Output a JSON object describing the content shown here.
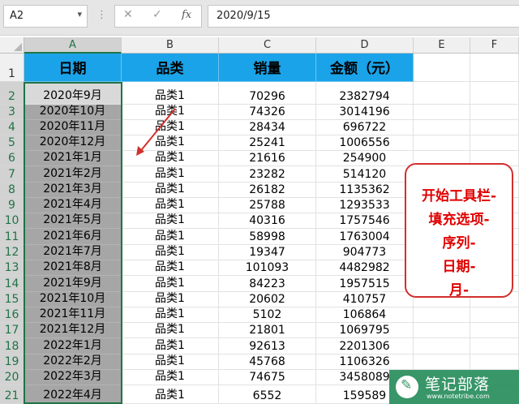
{
  "formula_bar": {
    "name_box": "A2",
    "name_box_arrow": "▾",
    "separator": "⋮",
    "cancel_glyph": "✕",
    "enter_glyph": "✓",
    "fx_glyph": "fx",
    "formula_value": "2020/9/15"
  },
  "columns": [
    "A",
    "B",
    "C",
    "D",
    "E",
    "F"
  ],
  "rows": [
    "1",
    "2",
    "3",
    "4",
    "5",
    "6",
    "7",
    "8",
    "9",
    "10",
    "11",
    "12",
    "13",
    "14",
    "15",
    "16",
    "17",
    "18",
    "19",
    "20",
    "21"
  ],
  "table": {
    "headers": [
      "日期",
      "品类",
      "销量",
      "金额（元）"
    ],
    "rows": [
      [
        "2020年9月",
        "品类1",
        "70296",
        "2382794"
      ],
      [
        "2020年10月",
        "品类1",
        "74326",
        "3014196"
      ],
      [
        "2020年11月",
        "品类1",
        "28434",
        "696722"
      ],
      [
        "2020年12月",
        "品类1",
        "25241",
        "1006556"
      ],
      [
        "2021年1月",
        "品类1",
        "21616",
        "254900"
      ],
      [
        "2021年2月",
        "品类1",
        "23282",
        "514120"
      ],
      [
        "2021年3月",
        "品类1",
        "26182",
        "1135362"
      ],
      [
        "2021年4月",
        "品类1",
        "25788",
        "1293533"
      ],
      [
        "2021年5月",
        "品类1",
        "40316",
        "1757546"
      ],
      [
        "2021年6月",
        "品类1",
        "58998",
        "1763004"
      ],
      [
        "2021年7月",
        "品类1",
        "19347",
        "904773"
      ],
      [
        "2021年8月",
        "品类1",
        "101093",
        "4482982"
      ],
      [
        "2021年9月",
        "品类1",
        "84223",
        "1957515"
      ],
      [
        "2021年10月",
        "品类1",
        "20602",
        "410757"
      ],
      [
        "2021年11月",
        "品类1",
        "5102",
        "106864"
      ],
      [
        "2021年12月",
        "品类1",
        "21801",
        "1069795"
      ],
      [
        "2022年1月",
        "品类1",
        "92613",
        "2201306"
      ],
      [
        "2022年2月",
        "品类1",
        "45768",
        "1106326"
      ],
      [
        "2022年3月",
        "品类1",
        "74675",
        "3458089"
      ],
      [
        "2022年4月",
        "品类1",
        "6552",
        "159589"
      ]
    ]
  },
  "annotation": {
    "lines": [
      "开始工具栏-",
      "填充选项-",
      "序列-",
      "日期-",
      "月-"
    ]
  },
  "watermark": {
    "title": "笔记部落",
    "url": "www.notetribe.com"
  },
  "colors": {
    "header_fill": "#1aa3e8",
    "selection_fill": "#a6a6a6",
    "selection_border": "#217346",
    "annotation_red": "#e00000",
    "watermark_green": "#2a8f5e"
  }
}
